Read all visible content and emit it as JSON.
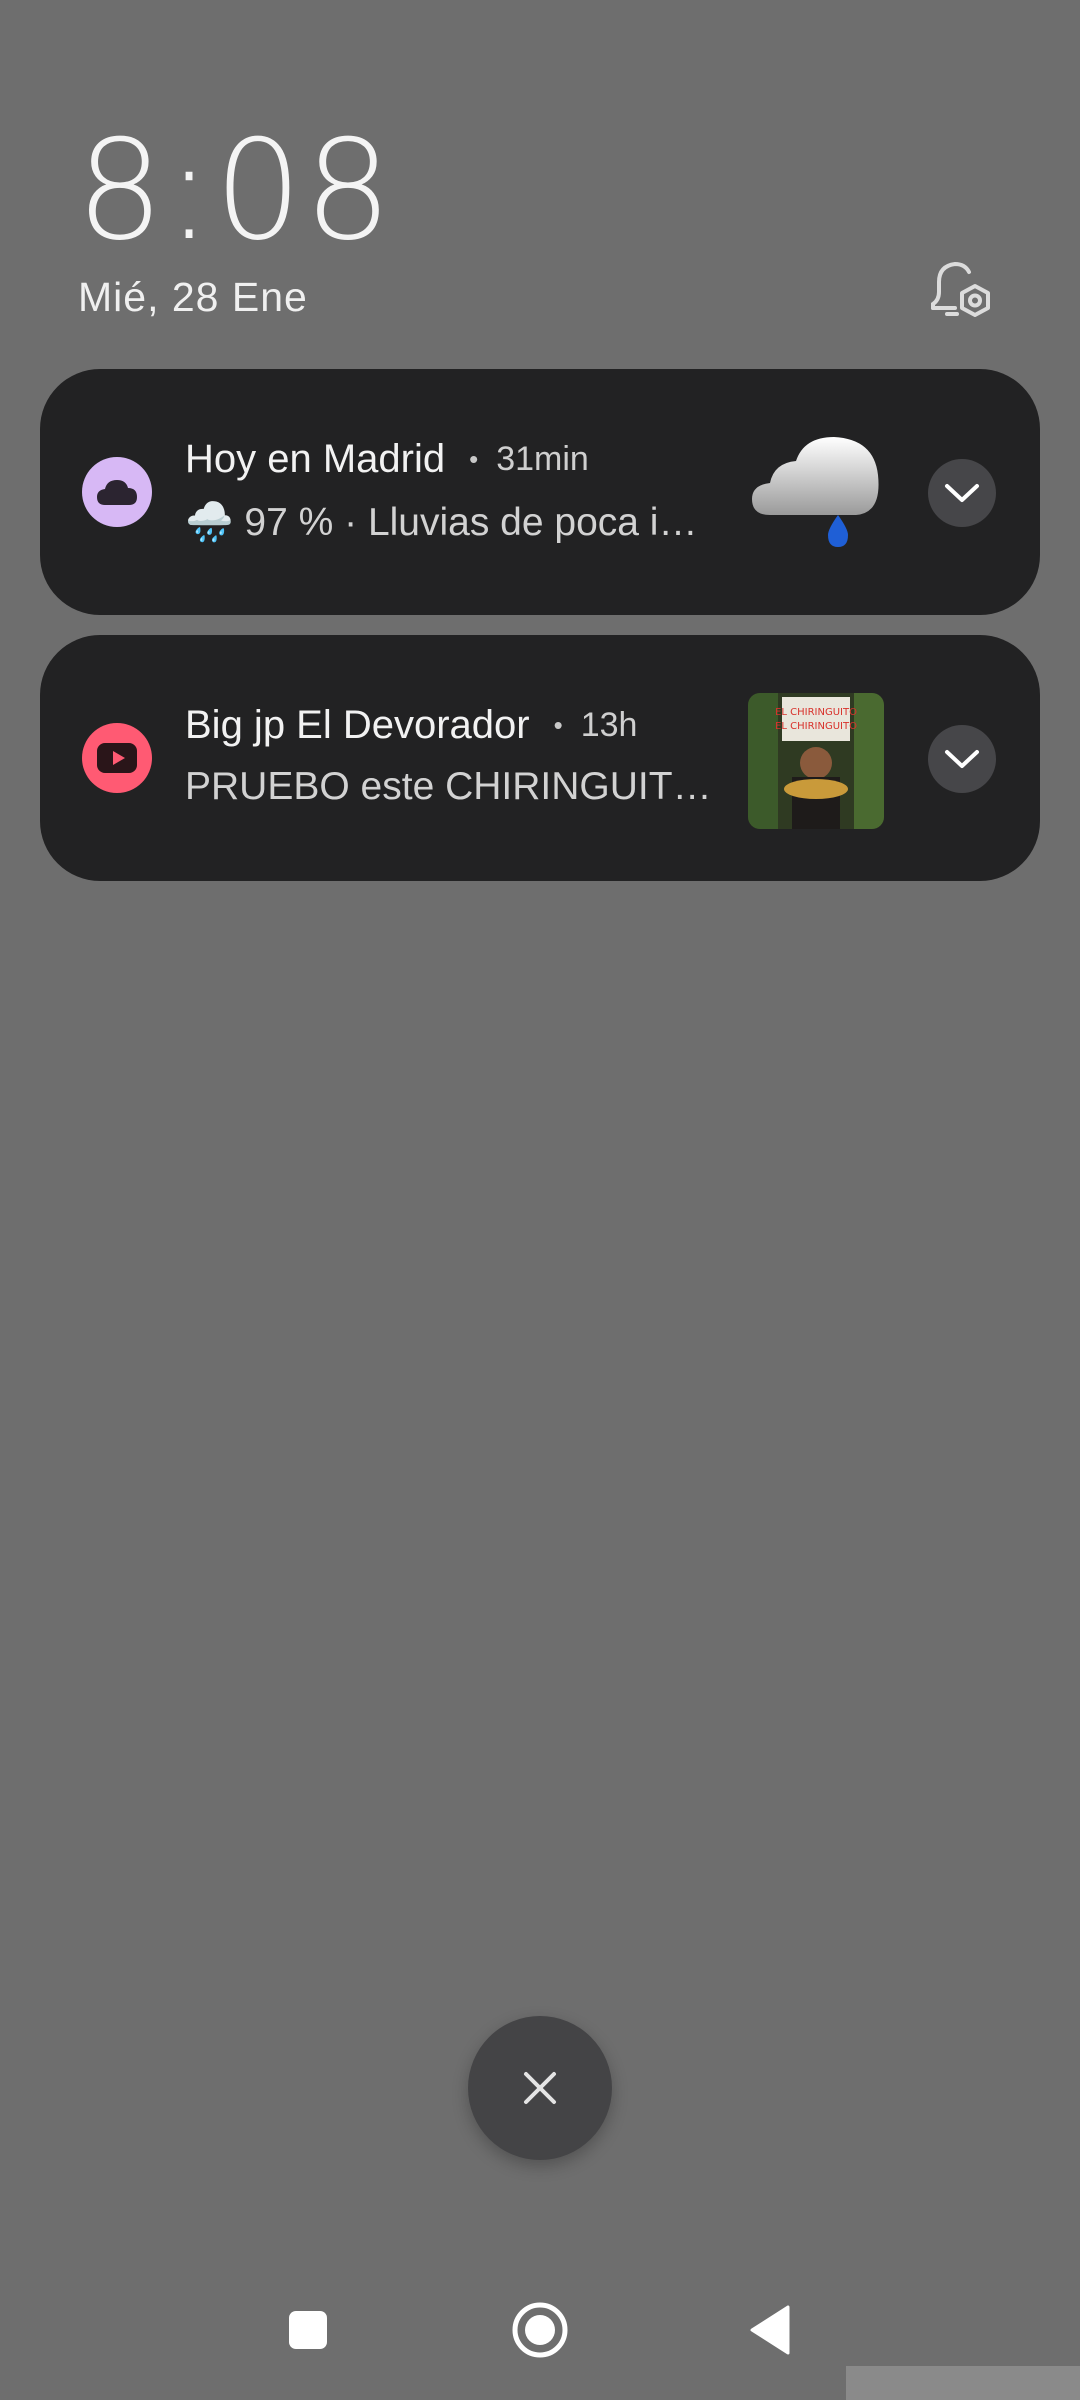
{
  "lockscreen": {
    "time": "8:08",
    "date": "Mié, 28 Ene"
  },
  "notifications": [
    {
      "app_icon": "cloud-icon",
      "icon_color": "#d7b8f5",
      "title": "Hoy en Madrid",
      "time": "31min",
      "body": "🌧️ 97 % · Lluvias de poca i…",
      "thumbnail": "rain-cloud-image"
    },
    {
      "app_icon": "youtube-play-icon",
      "icon_color": "#ff5a73",
      "title": "Big jp El Devorador",
      "time": "13h",
      "body": "PRUEBO este CHIRINGUIT…",
      "thumbnail": "video-thumbnail",
      "thumbnail_text": "EL CHIRINGUITO EL CHIRINGUITO"
    }
  ],
  "icons": {
    "settings": "bell-settings-icon",
    "clear": "close-icon",
    "nav": [
      "recents-square-icon",
      "home-circle-icon",
      "back-triangle-icon"
    ]
  },
  "colors": {
    "background": "#6e6e6e",
    "card": "#222223",
    "expand_button": "#464649"
  }
}
